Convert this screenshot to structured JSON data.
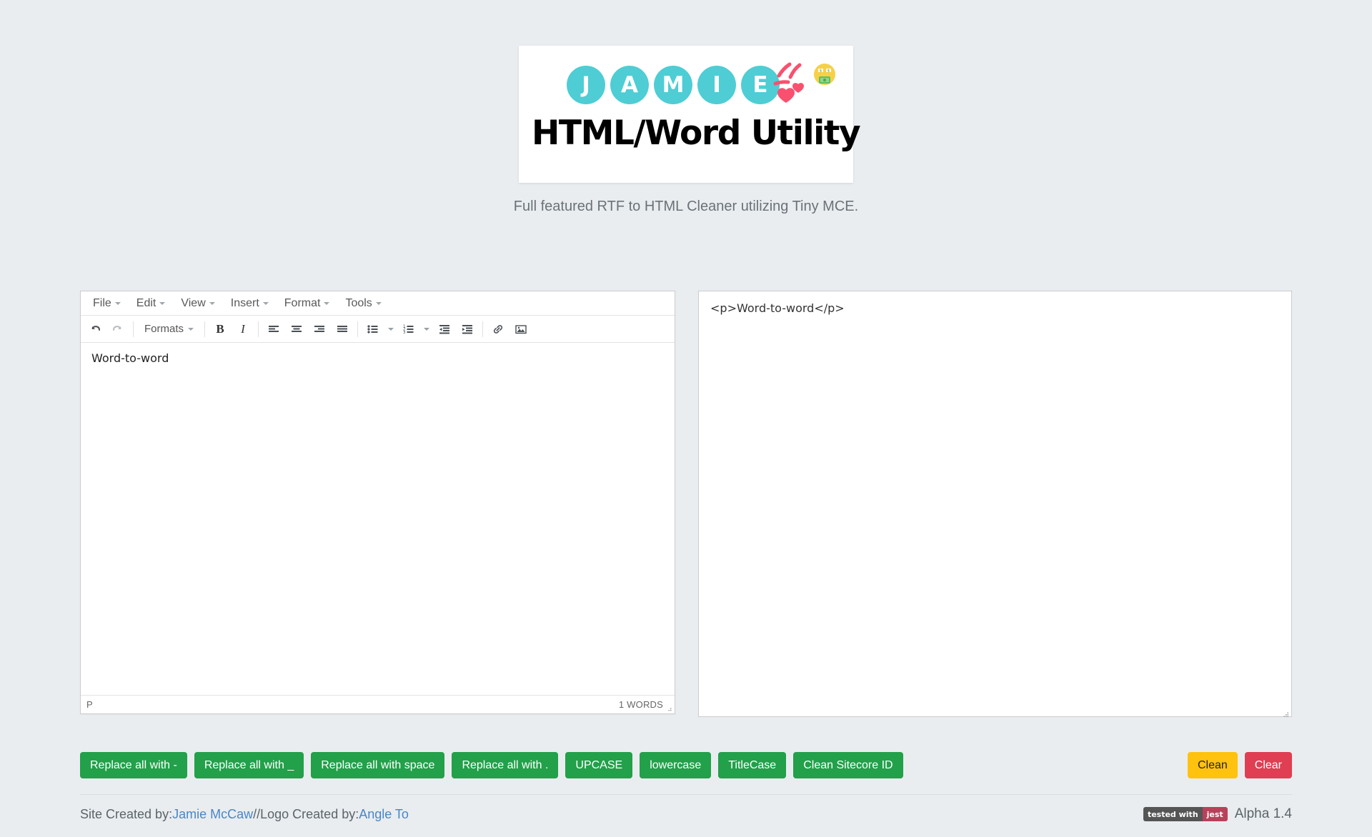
{
  "page": {
    "background": "#e9edf0",
    "subtitle": "Full featured RTF to HTML Cleaner utilizing Tiny MCE."
  },
  "logo": {
    "letters": [
      "J",
      "A",
      "M",
      "I",
      "E"
    ],
    "title": "HTML/Word Utility",
    "circle_color": "#4ecdd4",
    "accent_color": "#f9506f",
    "emoji": "money-mouth-face"
  },
  "editor": {
    "menubar": [
      {
        "label": "File"
      },
      {
        "label": "Edit"
      },
      {
        "label": "View"
      },
      {
        "label": "Insert"
      },
      {
        "label": "Format"
      },
      {
        "label": "Tools"
      }
    ],
    "toolbar": {
      "undo_icon": "undo-icon",
      "redo_icon": "redo-icon",
      "formats_label": "Formats",
      "bold_label": "B",
      "italic_label": "I",
      "align_left_icon": "align-left-icon",
      "align_center_icon": "align-center-icon",
      "align_right_icon": "align-right-icon",
      "align_justify_icon": "align-justify-icon",
      "bullet_list_icon": "bullet-list-icon",
      "numbered_list_icon": "numbered-list-icon",
      "outdent_icon": "outdent-icon",
      "indent_icon": "indent-icon",
      "link_icon": "link-icon",
      "image_icon": "image-icon"
    },
    "content": "Word-to-word",
    "statusbar": {
      "path": "P",
      "word_count": "1 WORDS"
    }
  },
  "code_output": {
    "value": "<p>Word-to-word</p>",
    "placeholder": ""
  },
  "actions": {
    "transform_buttons": [
      {
        "label": "Replace all with -",
        "color": "#22a04a"
      },
      {
        "label": "Replace all with _",
        "color": "#22a04a"
      },
      {
        "label": "Replace all with space",
        "color": "#22a04a"
      },
      {
        "label": "Replace all with .",
        "color": "#22a04a"
      },
      {
        "label": "UPCASE",
        "color": "#22a04a"
      },
      {
        "label": "lowercase",
        "color": "#22a04a"
      },
      {
        "label": "TitleCase",
        "color": "#22a04a"
      },
      {
        "label": "Clean Sitecore ID",
        "color": "#22a04a"
      }
    ],
    "clean_label": "Clean",
    "clean_color": "#ffc20e",
    "clear_label": "Clear",
    "clear_color": "#e03e52"
  },
  "footer": {
    "site_created_prefix": "Site Created by: ",
    "site_author": "Jamie McCaw",
    "separator": " // ",
    "logo_created_prefix": "Logo Created by: ",
    "logo_author": "Angle To",
    "badge_left": "tested with",
    "badge_right": "jest",
    "version": "Alpha 1.4"
  }
}
